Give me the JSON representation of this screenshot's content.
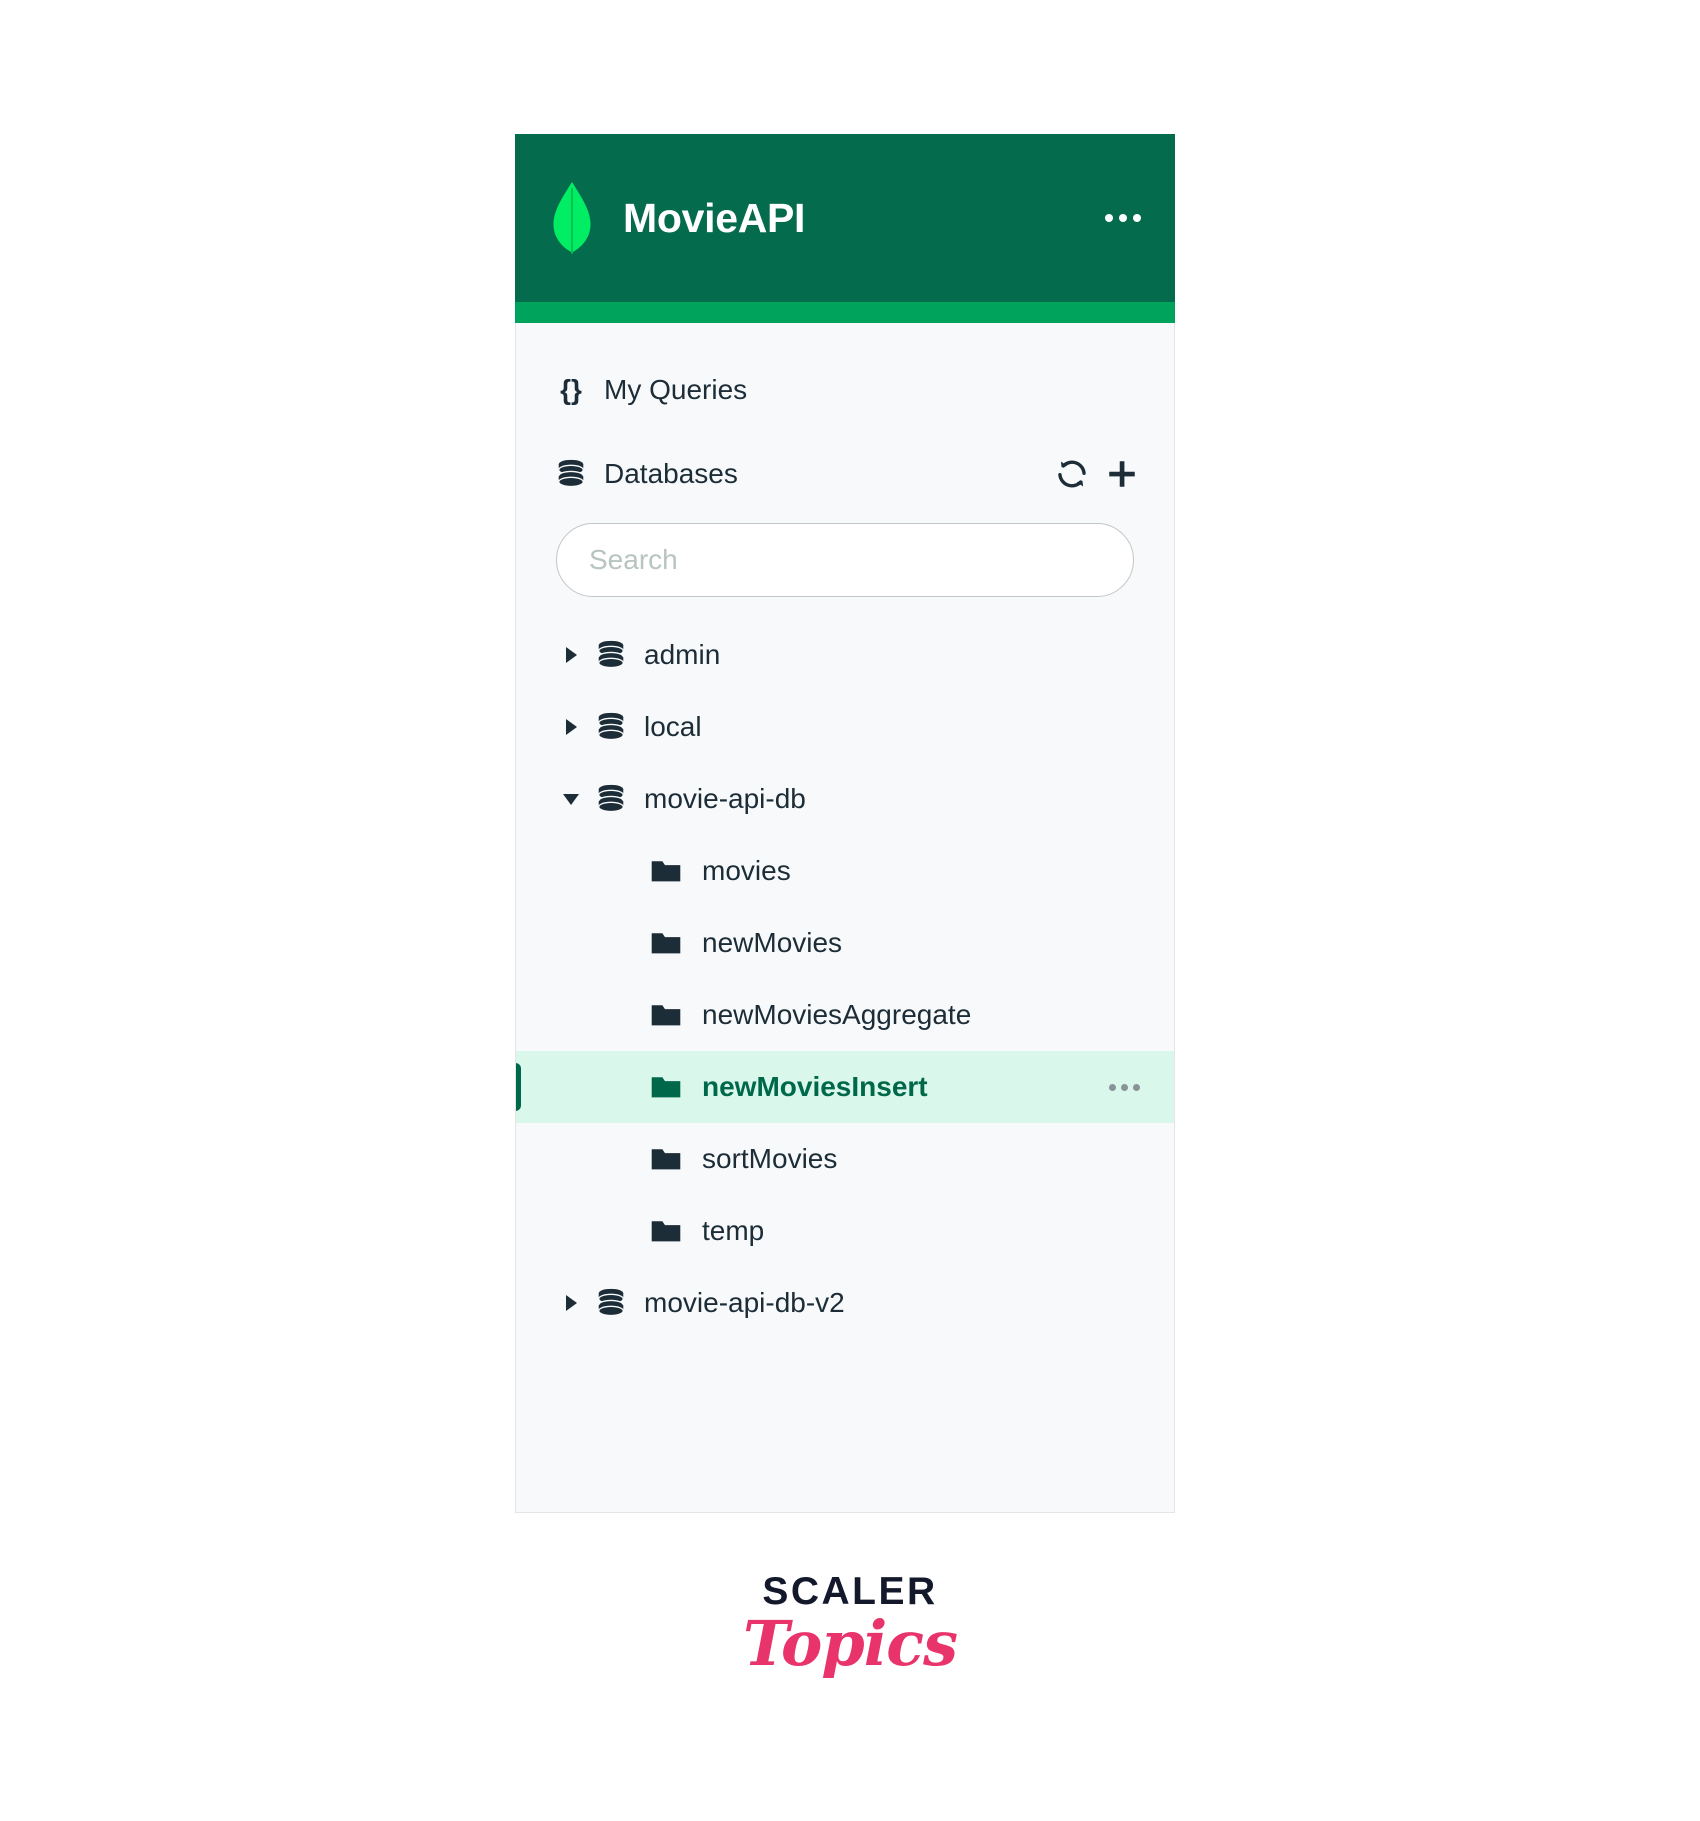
{
  "header": {
    "title": "MovieAPI",
    "logo_icon": "mongodb-leaf-icon",
    "menu_icon": "ellipsis-icon",
    "bg_color": "#056b4d",
    "accent_color": "#00a35c",
    "leaf_color": "#00ed64"
  },
  "nav": {
    "my_queries": {
      "label": "My Queries",
      "icon": "braces-icon",
      "glyph": "{}"
    },
    "databases": {
      "label": "Databases",
      "icon": "database-stack-icon",
      "refresh_icon": "refresh-icon",
      "add_icon": "plus-icon"
    }
  },
  "search": {
    "placeholder": "Search",
    "value": ""
  },
  "tree": [
    {
      "name": "admin",
      "type": "database",
      "icon": "database-stack-icon",
      "expanded": false,
      "caret": "caret-right-icon"
    },
    {
      "name": "local",
      "type": "database",
      "icon": "database-stack-icon",
      "expanded": false,
      "caret": "caret-right-icon"
    },
    {
      "name": "movie-api-db",
      "type": "database",
      "icon": "database-stack-icon",
      "expanded": true,
      "caret": "caret-down-icon"
    },
    {
      "name": "movies",
      "type": "collection",
      "icon": "folder-icon",
      "selected": false
    },
    {
      "name": "newMovies",
      "type": "collection",
      "icon": "folder-icon",
      "selected": false
    },
    {
      "name": "newMoviesAggregate",
      "type": "collection",
      "icon": "folder-icon",
      "selected": false
    },
    {
      "name": "newMoviesInsert",
      "type": "collection",
      "icon": "folder-icon",
      "selected": true,
      "menu_icon": "ellipsis-icon",
      "highlight_color": "#d9f7ea",
      "text_color": "#00684a"
    },
    {
      "name": "sortMovies",
      "type": "collection",
      "icon": "folder-icon",
      "selected": false
    },
    {
      "name": "temp",
      "type": "collection",
      "icon": "folder-icon",
      "selected": false
    },
    {
      "name": "movie-api-db-v2",
      "type": "database",
      "icon": "database-stack-icon",
      "expanded": false,
      "caret": "caret-right-icon"
    }
  ],
  "watermark": {
    "primary": "SCALER",
    "secondary": "Topics",
    "primary_color": "#13182b",
    "secondary_color": "#e8336b"
  }
}
